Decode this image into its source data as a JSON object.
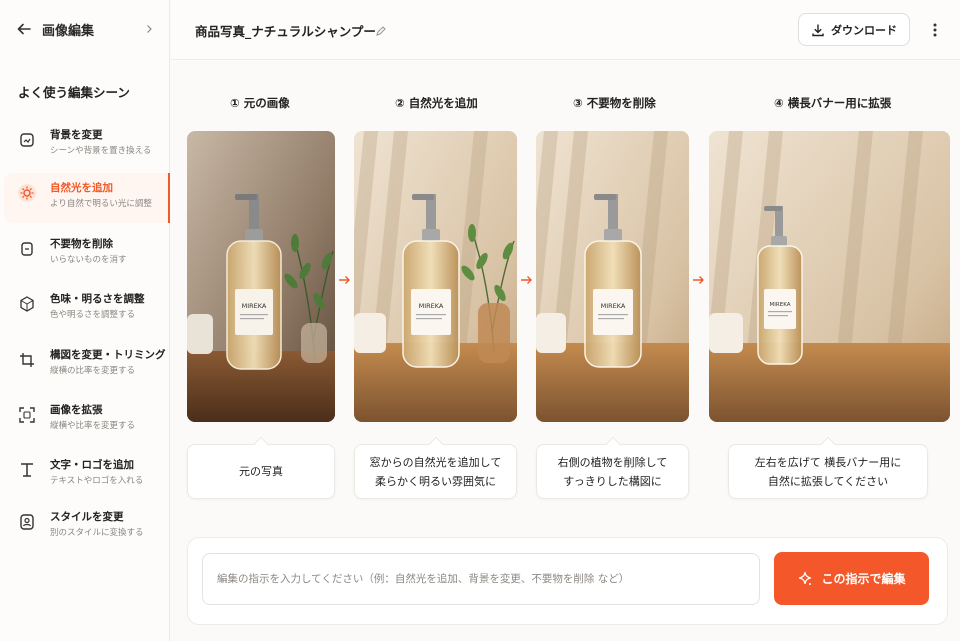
{
  "sidebar": {
    "title": "画像編集",
    "section_title": "よく使う編集シーン",
    "items": [
      {
        "label": "背景を変更",
        "sub": "シーンや背景を置き換える",
        "icon": "background-icon"
      },
      {
        "label": "自然光を追加",
        "sub": "より自然で明るい光に調整",
        "icon": "light-icon"
      },
      {
        "label": "不要物を削除",
        "sub": "いらないものを消す",
        "icon": "eraser-icon"
      },
      {
        "label": "色味・明るさを調整",
        "sub": "色や明るさを調整する",
        "icon": "color-adjust-icon"
      },
      {
        "label": "構図を変更・トリミング",
        "sub": "縦横の比率を変更する",
        "icon": "crop-icon"
      },
      {
        "label": "画像を拡張",
        "sub": "縦横や比率を変更する",
        "icon": "expand-icon"
      },
      {
        "label": "文字・ロゴを追加",
        "sub": "テキストやロゴを入れる",
        "icon": "text-icon"
      },
      {
        "label": "スタイルを変更",
        "sub": "別のスタイルに変換する",
        "icon": "style-icon"
      }
    ],
    "active_index": 1
  },
  "topbar": {
    "doc_title": "商品写真_ナチュラルシャンプー",
    "download_label": "ダウンロード"
  },
  "steps": [
    {
      "label": "① 元の画像",
      "caption_line1": "元の写真",
      "caption_line2": ""
    },
    {
      "label": "② 自然光を追加",
      "caption_line1": "窓からの自然光を追加して",
      "caption_line2": "柔らかく明るい雰囲気に"
    },
    {
      "label": "③ 不要物を削除",
      "caption_line1": "右側の植物を削除して",
      "caption_line2": "すっきりした構図に"
    },
    {
      "label": "④ 横長バナー用に拡張",
      "caption_line1": "左右を広げて 横長バナー用に",
      "caption_line2": "自然に拡張してください"
    }
  ],
  "product": {
    "brand": "MIREKA"
  },
  "instruction": {
    "value": "",
    "placeholder": "編集の指示を入力してください（例：自然光を追加、背景を変更、不要物を削除 など）",
    "apply_label": "この指示で編集"
  },
  "colors": {
    "accent": "#f4582a",
    "active_bg": "#fff6f2"
  }
}
